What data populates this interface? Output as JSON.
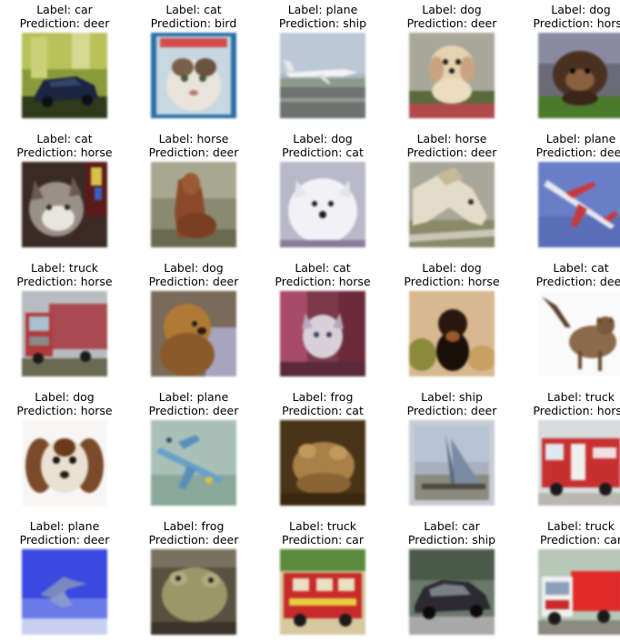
{
  "figure": {
    "label_prefix": "Label: ",
    "prediction_prefix": "Prediction: ",
    "samples": [
      {
        "label": "car",
        "prediction": "deer",
        "image": "car-image"
      },
      {
        "label": "cat",
        "prediction": "bird",
        "image": "cat-image"
      },
      {
        "label": "plane",
        "prediction": "ship",
        "image": "plane-image"
      },
      {
        "label": "dog",
        "prediction": "deer",
        "image": "dog-image"
      },
      {
        "label": "dog",
        "prediction": "horse",
        "image": "dog-image"
      },
      {
        "label": "cat",
        "prediction": "horse",
        "image": "cat-image"
      },
      {
        "label": "horse",
        "prediction": "deer",
        "image": "horse-image"
      },
      {
        "label": "dog",
        "prediction": "cat",
        "image": "dog-image"
      },
      {
        "label": "horse",
        "prediction": "deer",
        "image": "horse-image"
      },
      {
        "label": "plane",
        "prediction": "deer",
        "image": "plane-image"
      },
      {
        "label": "truck",
        "prediction": "horse",
        "image": "truck-image"
      },
      {
        "label": "dog",
        "prediction": "deer",
        "image": "dog-image"
      },
      {
        "label": "cat",
        "prediction": "horse",
        "image": "cat-image"
      },
      {
        "label": "dog",
        "prediction": "horse",
        "image": "dog-image"
      },
      {
        "label": "cat",
        "prediction": "deer",
        "image": "cat-image"
      },
      {
        "label": "dog",
        "prediction": "horse",
        "image": "dog-image"
      },
      {
        "label": "plane",
        "prediction": "deer",
        "image": "plane-image"
      },
      {
        "label": "frog",
        "prediction": "cat",
        "image": "frog-image"
      },
      {
        "label": "ship",
        "prediction": "deer",
        "image": "ship-image"
      },
      {
        "label": "truck",
        "prediction": "horse",
        "image": "truck-image"
      },
      {
        "label": "plane",
        "prediction": "deer",
        "image": "plane-image"
      },
      {
        "label": "frog",
        "prediction": "deer",
        "image": "frog-image"
      },
      {
        "label": "truck",
        "prediction": "car",
        "image": "truck-image"
      },
      {
        "label": "car",
        "prediction": "ship",
        "image": "car-image"
      },
      {
        "label": "truck",
        "prediction": "car",
        "image": "truck-image"
      }
    ]
  }
}
